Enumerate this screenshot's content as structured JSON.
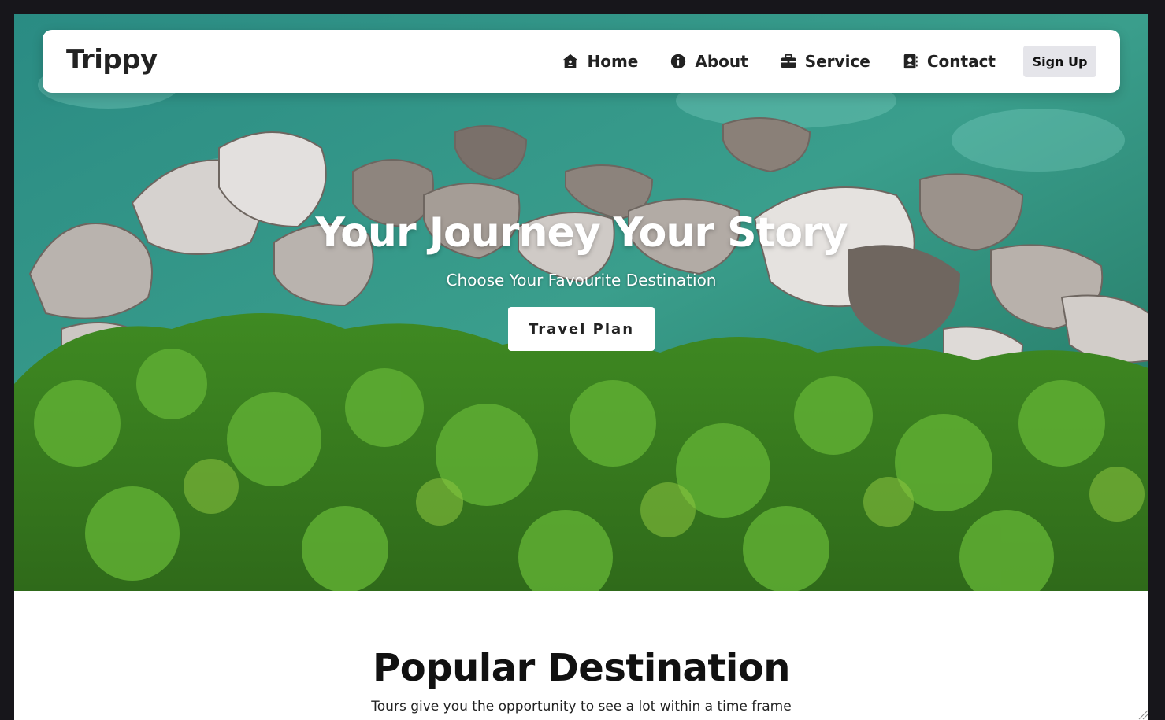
{
  "brand": {
    "name": "Trippy"
  },
  "nav": {
    "items": [
      {
        "label": "Home",
        "icon": "home-icon"
      },
      {
        "label": "About",
        "icon": "info-circle-icon"
      },
      {
        "label": "Service",
        "icon": "briefcase-icon"
      },
      {
        "label": "Contact",
        "icon": "address-book-icon"
      }
    ],
    "signup_label": "Sign Up"
  },
  "hero": {
    "title": "Your Journey Your Story",
    "subtitle": "Choose Your Favourite Destination",
    "cta_label": "Travel Plan"
  },
  "section": {
    "title": "Popular Destination",
    "subtitle": "Tours give you the opportunity to see a lot within a time frame"
  },
  "colors": {
    "page_background": "#17161b",
    "navbar_background": "#ffffff",
    "signup_button_background": "#e5e5ea",
    "text_dark": "#222222",
    "sea": "#2f8f84",
    "forest": "#4c9a2a"
  }
}
